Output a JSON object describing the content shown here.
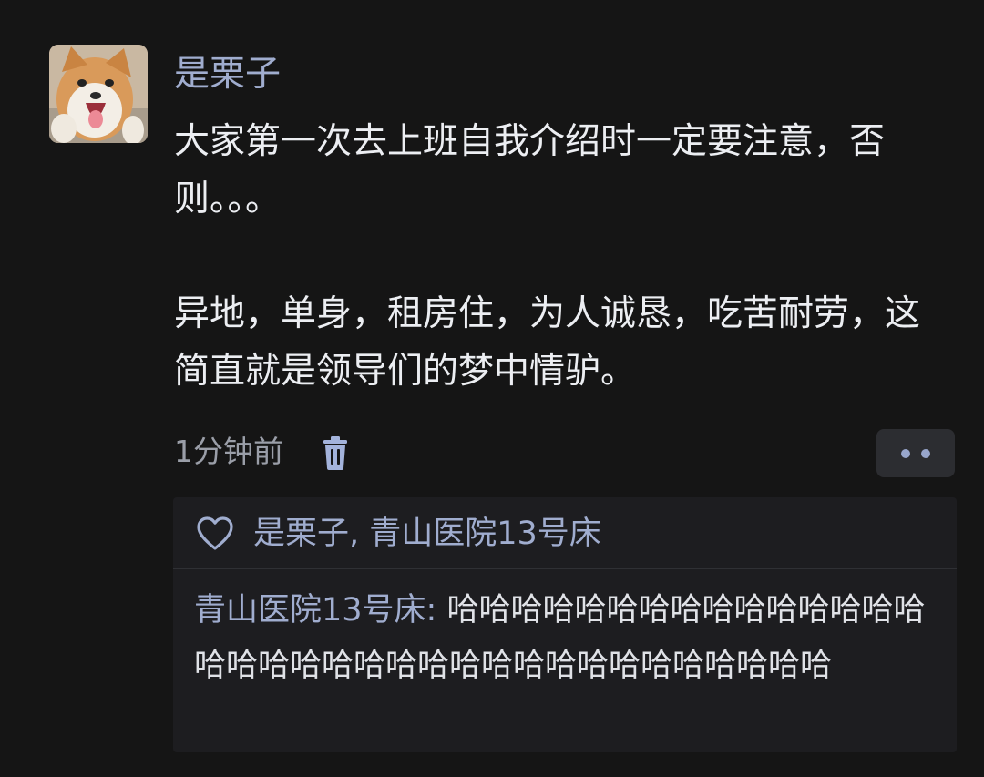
{
  "post": {
    "username": "是栗子",
    "paragraphs": [
      "大家第一次去上班自我介绍时一定要注意，否则。。。",
      "异地，单身，租房住，为人诚恳，吃苦耐劳，这简直就是领导们的梦中情驴。"
    ],
    "timestamp": "1分钟前"
  },
  "interactions": {
    "likes": "是栗子, 青山医院13号床",
    "reply": {
      "author": "青山医院13号床:",
      "text": "哈哈哈哈哈哈哈哈哈哈哈哈哈哈哈哈哈哈哈哈哈哈哈哈哈哈哈哈哈哈哈哈哈哈哈"
    }
  },
  "icons": {
    "delete": "trash-icon",
    "more": "more-dots-icon",
    "like": "heart-icon"
  },
  "colors": {
    "background": "#151515",
    "name_accent": "#a0adcf",
    "body_text": "#eceef2",
    "muted_text": "#9a9ea8",
    "panel": "#1d1d20"
  }
}
